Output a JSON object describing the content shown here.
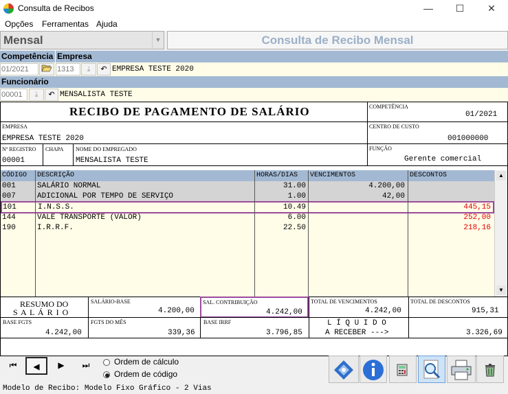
{
  "window": {
    "title": "Consulta de Recibos",
    "minimize": "—",
    "maximize": "☐",
    "close": "✕"
  },
  "menu": [
    "Opções",
    "Ferramentas",
    "Ajuda"
  ],
  "mode": {
    "selected": "Mensal",
    "title": "Consulta de Recibo Mensal"
  },
  "filters": {
    "competencia_label": "Competência",
    "empresa_label": "Empresa",
    "competencia": "01/2021",
    "empresa_code": "1313",
    "empresa_name": "EMPRESA TESTE 2020",
    "funcionario_label": "Funcionário",
    "funcionario_code": "00001",
    "funcionario_name": "MENSALISTA TESTE"
  },
  "receipt": {
    "title": "RECIBO DE PAGAMENTO DE SALÁRIO",
    "competencia_label": "COMPETÊNCIA",
    "competencia": "01/2021",
    "empresa_label": "EMPRESA",
    "empresa": "EMPRESA TESTE 2020",
    "centro_label": "CENTRO DE CUSTO",
    "centro": "001000000",
    "registro_label": "Nº REGISTRO",
    "registro": "00001",
    "chapa_label": "CHAPA",
    "nome_label": "NOME DO EMPREGADO",
    "nome": "MENSALISTA TESTE",
    "funcao_label": "FUNÇÃO",
    "funcao": "Gerente comercial",
    "columns": [
      "CÓDIGO",
      "DESCRIÇÃO",
      "HORAS/DIAS",
      "VENCIMENTOS",
      "DESCONTOS"
    ],
    "rows": [
      {
        "codigo": "001",
        "descricao": "SALÁRIO NORMAL",
        "horas": "31.00",
        "venc": "4.200,00",
        "desc": ""
      },
      {
        "codigo": "007",
        "descricao": "ADICIONAL POR TEMPO DE SERVIÇO",
        "horas": "1.00",
        "venc": "42,00",
        "desc": ""
      },
      {
        "codigo": "101",
        "descricao": "I.N.S.S.",
        "horas": "10.49",
        "venc": "",
        "desc": "445,15"
      },
      {
        "codigo": "144",
        "descricao": "VALE TRANSPORTE (VALOR)",
        "horas": "6.00",
        "venc": "",
        "desc": "252,00"
      },
      {
        "codigo": "190",
        "descricao": "I.R.R.F.",
        "horas": "22.50",
        "venc": "",
        "desc": "218,16"
      }
    ],
    "resumo_line1": "RESUMO DO",
    "resumo_line2": "S A L Á R I O",
    "salario_base_label": "SALÁRIO-BASE",
    "salario_base": "4.200,00",
    "sal_contrib_label": "SAL. CONTRIBUIÇÃO",
    "sal_contrib": "4.242,00",
    "total_venc_label": "TOTAL DE VENCIMENTOS",
    "total_venc": "4.242,00",
    "total_desc_label": "TOTAL DE DESCONTOS",
    "total_desc": "915,31",
    "base_fgts_label": "BASE FGTS",
    "base_fgts": "4.242,00",
    "fgts_mes_label": "FGTS DO MÊS",
    "fgts_mes": "339,36",
    "base_irrf_label": "BASE IRRF",
    "base_irrf": "3.796,85",
    "liquido_line1": "L Í Q U I D O",
    "liquido_line2": "A RECEBER --->",
    "liquido": "3.326,69"
  },
  "order": {
    "option1": "Ordem de cálculo",
    "option2": "Ordem de código",
    "selected": "Ordem de código"
  },
  "status": "Modelo de Recibo: Modelo Fixo Gráfico - 2 Vias",
  "colors": {
    "header_blue": "#a3b9d3",
    "mode_title": "#9bb0c8",
    "highlight": "#9b4a9b",
    "discount_red": "#d00000"
  }
}
